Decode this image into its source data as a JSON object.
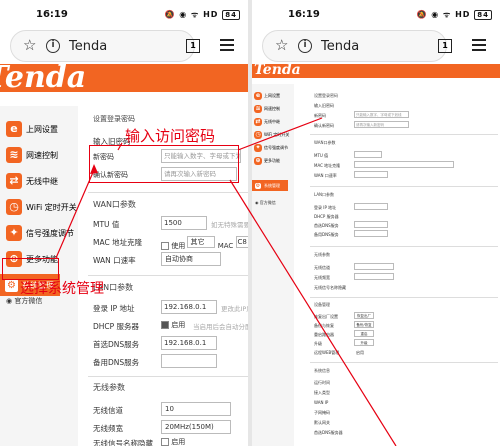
{
  "status": {
    "time": "16:19",
    "battery": "84",
    "icons": "🔕 ◉ ᯤ HD"
  },
  "browser": {
    "host": "Tenda",
    "tab_count": "1"
  },
  "brand": {
    "logo": "Tenda"
  },
  "sidebar": {
    "items": [
      {
        "label": "上网设置",
        "icon": "e"
      },
      {
        "label": "网速控制",
        "icon": "≋"
      },
      {
        "label": "无线中继",
        "icon": "⇄"
      },
      {
        "label": "WiFi 定时开关",
        "icon": "◷"
      },
      {
        "label": "信号强度调节",
        "icon": "✦"
      },
      {
        "label": "更多功能",
        "icon": "⊕"
      },
      {
        "label": "系统管理",
        "icon": "⚙"
      }
    ],
    "footer": [
      "官方微信"
    ]
  },
  "login": {
    "section": "设置登录密码",
    "old_label": "输入旧密码",
    "new_label": "新密码",
    "new_placeholder": "只能输入数字、字母或下划线",
    "confirm_label": "确认新密码",
    "confirm_placeholder": "请再次输入新密码"
  },
  "wan": {
    "section": "WAN口参数",
    "mtu_label": "MTU 值",
    "mtu_value": "1500",
    "mtu_hint": "如无特殊需要",
    "mac_label": "MAC 地址克隆",
    "mac_use": "使用",
    "mac_other": "其它",
    "mac_word": "MAC",
    "mac_value": "C8",
    "speed_label": "WAN 口速率",
    "speed_value": "自动协商"
  },
  "lan": {
    "section": "LAN口参数",
    "ip_label": "登录 IP 地址",
    "ip_value": "192.168.0.1",
    "ip_hint": "更改此IP后",
    "dhcp_label": "DHCP 服务器",
    "dhcp_value": "启用",
    "dhcp_hint": "当启用后会自动分配",
    "dns1_label": "首选DNS服务",
    "dns1_value": "192.168.0.1",
    "dns2_label": "备用DNS服务"
  },
  "wireless": {
    "section": "无线参数",
    "channel_label": "无线信道",
    "channel_value": "10",
    "bandwidth_label": "无线频宽",
    "bandwidth_value": "20MHz(150M)",
    "hide_label": "无线信号名称隐藏",
    "hide_value": "启用"
  },
  "right": {
    "login_section": "设置登录密码",
    "old_label": "输入旧密码",
    "new_label": "新密码",
    "new_placeholder": "只能输入数字、字母或下划线",
    "confirm_label": "确认新密码",
    "confirm_placeholder": "请再次输入新密码",
    "wan_section": "WAN口参数",
    "mtu_label": "MTU 值",
    "mac_label": "MAC 地址克隆",
    "speed_label": "WAN 口速率",
    "lan_section": "LAN口参数",
    "ip_label": "登录 IP 地址",
    "dhcp_label": "DHCP 服务器",
    "dns1_label": "首选DNS服务",
    "dns2_label": "备用DNS服务",
    "wireless_section": "无线参数",
    "channel_label": "无线信道",
    "bandwidth_label": "无线频宽",
    "hide_label": "无线信号名称隐藏",
    "device_section": "设备管理",
    "row1_label": "恢复出厂设置",
    "row1_btn": "恢复出厂",
    "row2_label": "备份与恢复",
    "row2_btn": "备份/恢复",
    "row3_label": "重启路由器",
    "row3_btn": "重启",
    "row4_label": "升级",
    "row4_btn": "升级",
    "row5_label": "远程WEB管理",
    "row5_value": "启用",
    "info_section": "系统信息",
    "info_rows": [
      "运行时间",
      "接入类型",
      "WAN IP",
      "子网掩码",
      "默认网关",
      "首选DNS服务器"
    ]
  },
  "annotations": {
    "password": "输入访问密码",
    "system": "选择系统管理"
  },
  "colors": {
    "brand": "#f26522",
    "annotation": "#e60012"
  }
}
